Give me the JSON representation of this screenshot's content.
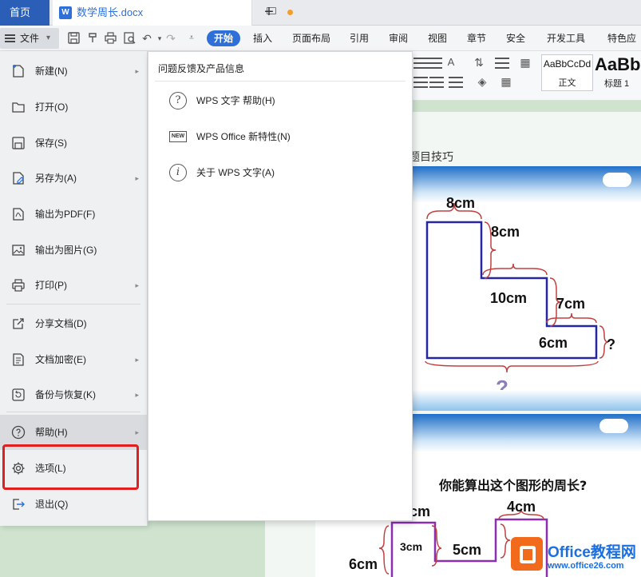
{
  "tabbar": {
    "home": "首页",
    "doc_icon": "W",
    "doc_name": "数学周长.docx"
  },
  "toolbar": {
    "file_label": "文件",
    "tabs": [
      "开始",
      "插入",
      "页面布局",
      "引用",
      "审阅",
      "视图",
      "章节",
      "安全",
      "开发工具",
      "特色应用"
    ]
  },
  "ribbon": {
    "styles": [
      {
        "sample": "AaBbCcDd",
        "name": "正文"
      },
      {
        "sample": "AaBb",
        "name": "标题 1"
      }
    ]
  },
  "file_menu": {
    "items": [
      {
        "label": "新建(N)",
        "icon": "new-doc-icon",
        "arrow": true
      },
      {
        "label": "打开(O)",
        "icon": "folder-open-icon",
        "arrow": false
      },
      {
        "label": "保存(S)",
        "icon": "save-icon",
        "arrow": false
      },
      {
        "label": "另存为(A)",
        "icon": "save-as-icon",
        "arrow": true
      },
      {
        "label": "输出为PDF(F)",
        "icon": "pdf-export-icon",
        "arrow": false
      },
      {
        "label": "输出为图片(G)",
        "icon": "image-export-icon",
        "arrow": false
      },
      {
        "label": "打印(P)",
        "icon": "printer-icon",
        "arrow": true
      },
      {
        "label": "分享文档(D)",
        "icon": "share-icon",
        "arrow": false
      },
      {
        "label": "文档加密(E)",
        "icon": "lock-doc-icon",
        "arrow": true
      },
      {
        "label": "备份与恢复(K)",
        "icon": "backup-icon",
        "arrow": true
      },
      {
        "label": "帮助(H)",
        "icon": "help-icon",
        "arrow": true
      },
      {
        "label": "选项(L)",
        "icon": "gear-icon",
        "arrow": false
      },
      {
        "label": "退出(Q)",
        "icon": "exit-icon",
        "arrow": false
      }
    ]
  },
  "help_submenu": {
    "header": "问题反馈及产品信息",
    "items": [
      {
        "label": "WPS 文字 帮助(H)",
        "icon": "question-circle-icon"
      },
      {
        "label": "WPS Office 新特性(N)",
        "icon": "new-badge-icon"
      },
      {
        "label": "关于 WPS 文字(A)",
        "icon": "info-circle-icon"
      }
    ]
  },
  "document": {
    "title_fragment": "题目技巧",
    "slide1": {
      "dims": [
        "8cm",
        "8cm",
        "10cm",
        "7cm",
        "6cm",
        "?"
      ]
    },
    "slide2": {
      "question": "你能算出这个图形的周长?",
      "dims": [
        "cm",
        "4cm",
        "3cm",
        "5cm",
        "6cm"
      ]
    }
  },
  "watermark": {
    "line1": "Office教程网",
    "line2": "www.office26.com"
  }
}
